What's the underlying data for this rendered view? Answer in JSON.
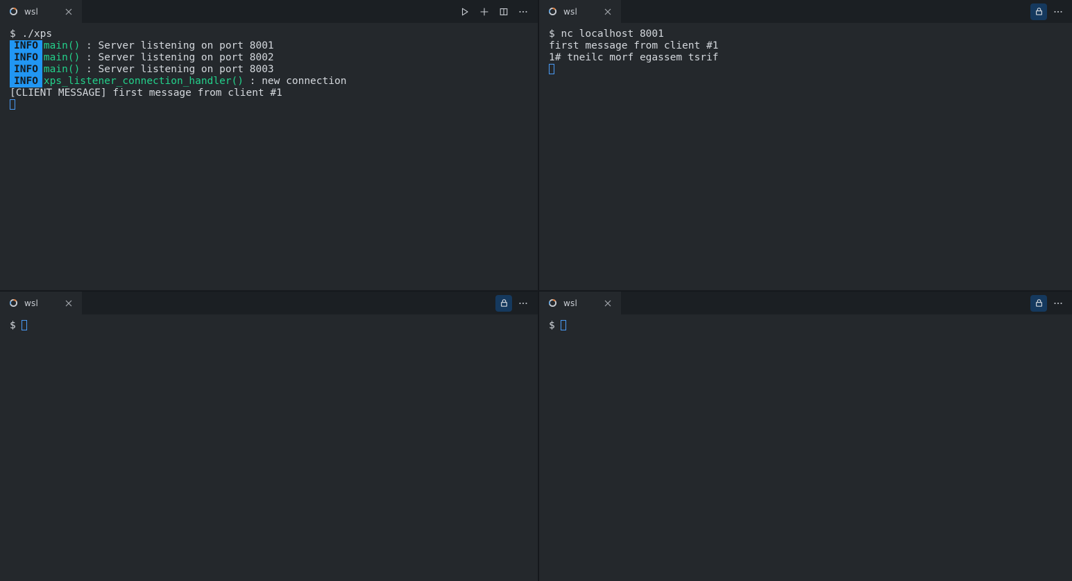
{
  "app": {
    "title": "Windows Terminal",
    "colors": {
      "window_bg": "#181b1f",
      "tabbar_bg": "#1b1f23",
      "tab_active_bg": "#24282c",
      "terminal_bg": "#24282c",
      "terminal_fg": "#d4d8dd",
      "accent_green": "#23d18b",
      "badge_blue": "#2196f3",
      "lock_active_bg": "#15395e",
      "cursor_blue": "#4a9bf5",
      "divider": "#13161a"
    }
  },
  "panes": [
    {
      "id": "top-left",
      "tab": {
        "label": "wsl",
        "icon": "wsl-icon",
        "close_icon": "close-icon"
      },
      "actions": [
        {
          "name": "run-icon",
          "label": "Run"
        },
        {
          "name": "new-tab-icon",
          "label": "New tab"
        },
        {
          "name": "split-pane-icon",
          "label": "Split pane"
        },
        {
          "name": "more-options-icon",
          "label": "More options"
        }
      ],
      "lines": [
        {
          "type": "plain",
          "text": "$ ./xps"
        },
        {
          "type": "log",
          "badge": "INFO",
          "func": "main()",
          "rest": " : Server listening on port 8001"
        },
        {
          "type": "log",
          "badge": "INFO",
          "func": "main()",
          "rest": " : Server listening on port 8002"
        },
        {
          "type": "log",
          "badge": "INFO",
          "func": "main()",
          "rest": " : Server listening on port 8003"
        },
        {
          "type": "log",
          "badge": "INFO",
          "func": "xps_listener_connection_handler()",
          "rest": " : new connection"
        },
        {
          "type": "plain",
          "text": "[CLIENT MESSAGE] first message from client #1"
        },
        {
          "type": "cursor",
          "text": ""
        }
      ]
    },
    {
      "id": "top-right",
      "tab": {
        "label": "wsl",
        "icon": "wsl-icon",
        "close_icon": "close-icon"
      },
      "actions": [
        {
          "name": "lock-icon",
          "label": "Read-only",
          "active": true
        },
        {
          "name": "more-options-icon",
          "label": "More options"
        }
      ],
      "lines": [
        {
          "type": "plain",
          "text": "$ nc localhost 8001"
        },
        {
          "type": "plain",
          "text": "first message from client #1"
        },
        {
          "type": "plain",
          "text": "1# tneilc morf egassem tsrif"
        },
        {
          "type": "cursor",
          "text": ""
        }
      ]
    },
    {
      "id": "bottom-left",
      "tab": {
        "label": "wsl",
        "icon": "wsl-icon",
        "close_icon": "close-icon"
      },
      "actions": [
        {
          "name": "lock-icon",
          "label": "Read-only",
          "active": true
        },
        {
          "name": "more-options-icon",
          "label": "More options"
        }
      ],
      "lines": [
        {
          "type": "cursor",
          "text": "$ "
        }
      ]
    },
    {
      "id": "bottom-right",
      "tab": {
        "label": "wsl",
        "icon": "wsl-icon",
        "close_icon": "close-icon"
      },
      "actions": [
        {
          "name": "lock-icon",
          "label": "Read-only",
          "active": true
        },
        {
          "name": "more-options-icon",
          "label": "More options"
        }
      ],
      "lines": [
        {
          "type": "cursor",
          "text": "$ "
        }
      ]
    }
  ]
}
